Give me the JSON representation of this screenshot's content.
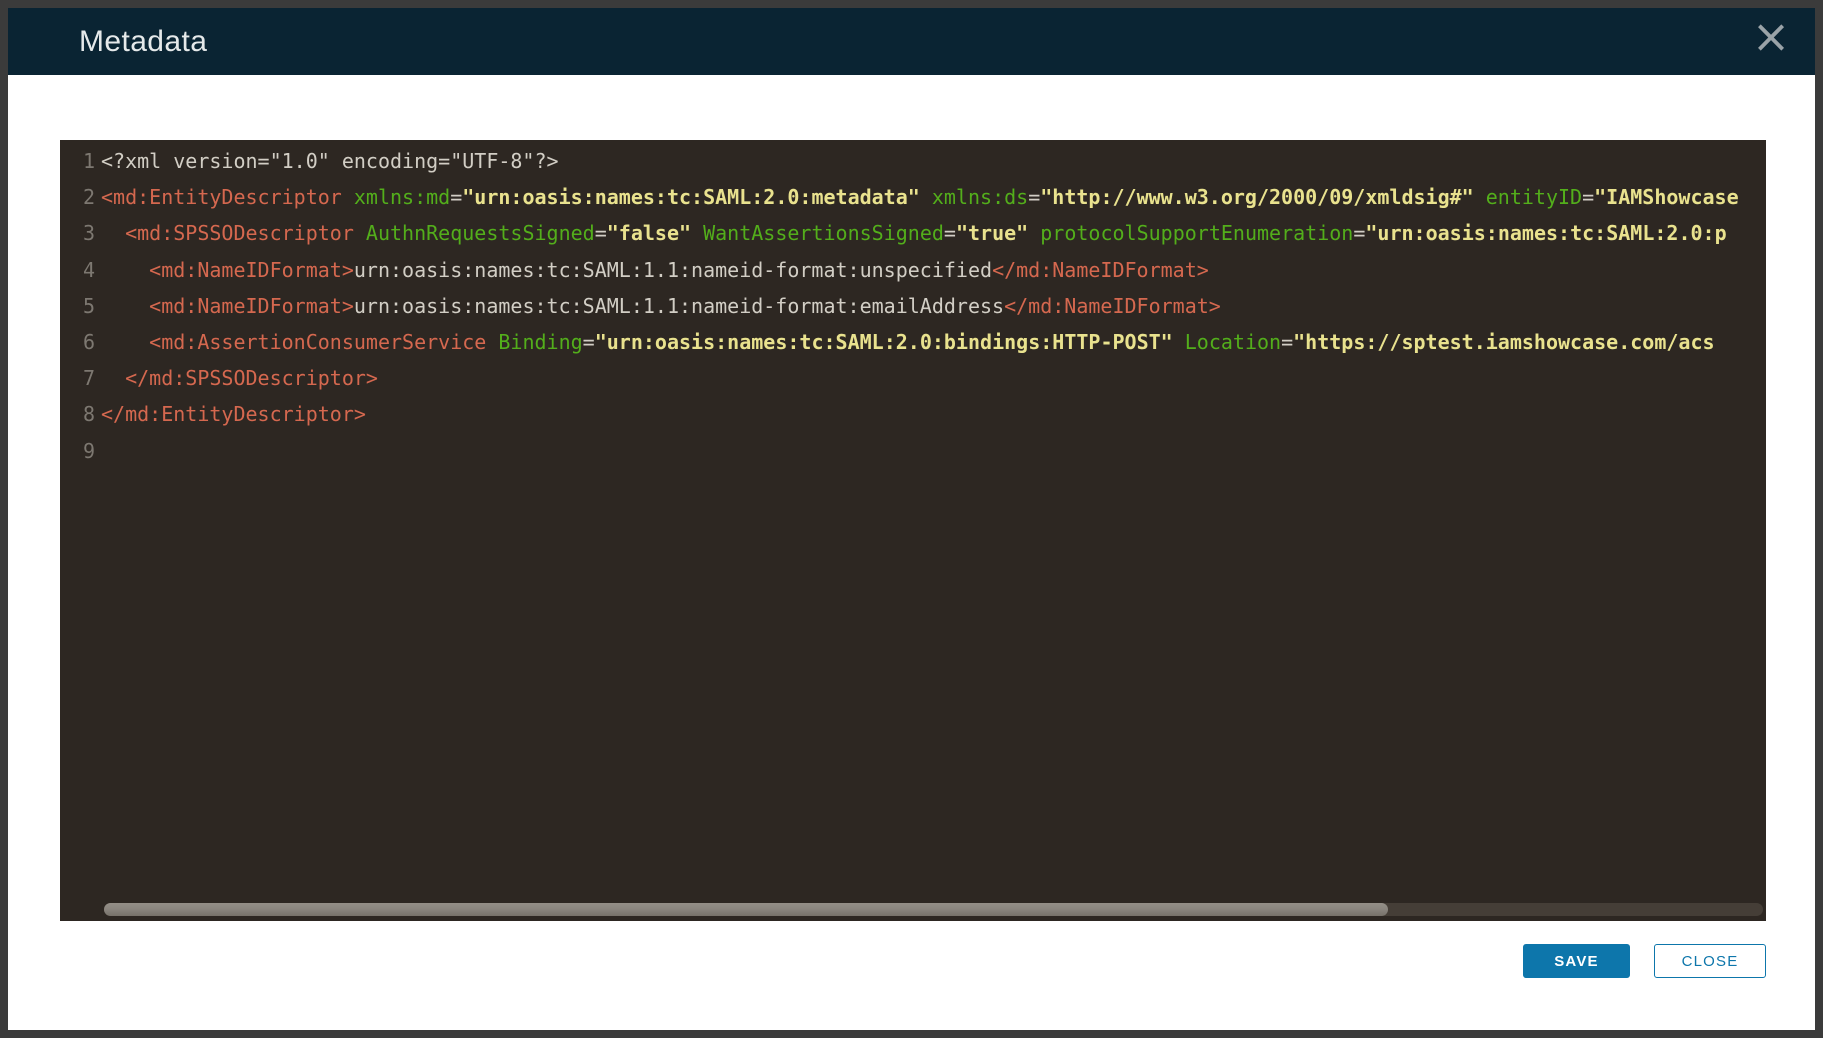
{
  "window": {
    "title": "Metadata",
    "close_icon": "×"
  },
  "colors": {
    "frame": "#3b3b3b",
    "header_bg": "#0a2433",
    "header_text": "#e5e9ea",
    "close_icon": "#9aa3a8",
    "editor_bg": "#2d2722",
    "line_number": "#7d7871",
    "code_plain": "#d2cec5",
    "code_tag": "#d5684f",
    "code_attr": "#53ae1b",
    "code_string": "#e9e28e",
    "button_blue": "#0d76ab",
    "scroll_track": "#453e37",
    "scroll_thumb": "#8b867f"
  },
  "editor": {
    "lines": [
      {
        "num": "1",
        "segments": [
          {
            "type": "plain",
            "text": "<?xml version=\"1.0\" encoding=\"UTF-8\"?>"
          }
        ]
      },
      {
        "num": "2",
        "segments": [
          {
            "type": "tag",
            "text": "<md:EntityDescriptor"
          },
          {
            "type": "plain",
            "text": " "
          },
          {
            "type": "attr",
            "text": "xmlns:md"
          },
          {
            "type": "plain",
            "text": "="
          },
          {
            "type": "string",
            "text": "\"urn:oasis:names:tc:SAML:2.0:metadata\""
          },
          {
            "type": "plain",
            "text": " "
          },
          {
            "type": "attr",
            "text": "xmlns:ds"
          },
          {
            "type": "plain",
            "text": "="
          },
          {
            "type": "string",
            "text": "\"http://www.w3.org/2000/09/xmldsig#\""
          },
          {
            "type": "plain",
            "text": " "
          },
          {
            "type": "attr",
            "text": "entityID"
          },
          {
            "type": "plain",
            "text": "="
          },
          {
            "type": "string",
            "text": "\"IAMShowcase"
          }
        ]
      },
      {
        "num": "3",
        "segments": [
          {
            "type": "plain",
            "text": "  "
          },
          {
            "type": "tag",
            "text": "<md:SPSSODescriptor"
          },
          {
            "type": "plain",
            "text": " "
          },
          {
            "type": "attr",
            "text": "AuthnRequestsSigned"
          },
          {
            "type": "plain",
            "text": "="
          },
          {
            "type": "string",
            "text": "\"false\""
          },
          {
            "type": "plain",
            "text": " "
          },
          {
            "type": "attr",
            "text": "WantAssertionsSigned"
          },
          {
            "type": "plain",
            "text": "="
          },
          {
            "type": "string",
            "text": "\"true\""
          },
          {
            "type": "plain",
            "text": " "
          },
          {
            "type": "attr",
            "text": "protocolSupportEnumeration"
          },
          {
            "type": "plain",
            "text": "="
          },
          {
            "type": "string",
            "text": "\"urn:oasis:names:tc:SAML:2.0:p"
          }
        ]
      },
      {
        "num": "4",
        "segments": [
          {
            "type": "plain",
            "text": "    "
          },
          {
            "type": "tag",
            "text": "<md:NameIDFormat>"
          },
          {
            "type": "plain",
            "text": "urn:oasis:names:tc:SAML:1.1:nameid-format:unspecified"
          },
          {
            "type": "tag",
            "text": "</md:NameIDFormat>"
          }
        ]
      },
      {
        "num": "5",
        "segments": [
          {
            "type": "plain",
            "text": "    "
          },
          {
            "type": "tag",
            "text": "<md:NameIDFormat>"
          },
          {
            "type": "plain",
            "text": "urn:oasis:names:tc:SAML:1.1:nameid-format:emailAddress"
          },
          {
            "type": "tag",
            "text": "</md:NameIDFormat>"
          }
        ]
      },
      {
        "num": "6",
        "segments": [
          {
            "type": "plain",
            "text": "    "
          },
          {
            "type": "tag",
            "text": "<md:AssertionConsumerService"
          },
          {
            "type": "plain",
            "text": " "
          },
          {
            "type": "attr",
            "text": "Binding"
          },
          {
            "type": "plain",
            "text": "="
          },
          {
            "type": "string",
            "text": "\"urn:oasis:names:tc:SAML:2.0:bindings:HTTP-POST\""
          },
          {
            "type": "plain",
            "text": " "
          },
          {
            "type": "attr",
            "text": "Location"
          },
          {
            "type": "plain",
            "text": "="
          },
          {
            "type": "string",
            "text": "\"https://sptest.iamshowcase.com/acs"
          }
        ]
      },
      {
        "num": "7",
        "segments": [
          {
            "type": "plain",
            "text": "  "
          },
          {
            "type": "tag",
            "text": "</md:SPSSODescriptor>"
          }
        ]
      },
      {
        "num": "8",
        "segments": [
          {
            "type": "tag",
            "text": "</md:EntityDescriptor>"
          }
        ]
      },
      {
        "num": "9",
        "segments": []
      }
    ]
  },
  "footer": {
    "save_label": "SAVE",
    "close_label": "CLOSE"
  }
}
